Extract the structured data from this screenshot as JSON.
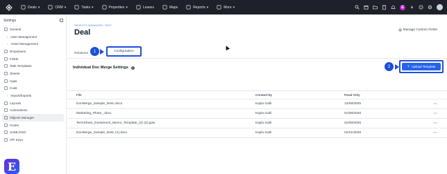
{
  "nav": {
    "items": [
      {
        "label": "Deals",
        "icon": "deals-icon",
        "has_menu": true
      },
      {
        "label": "CRM",
        "icon": "crm-icon",
        "has_menu": true
      },
      {
        "label": "Tasks",
        "icon": "tasks-icon",
        "has_menu": true
      },
      {
        "label": "Properties",
        "icon": "properties-icon",
        "has_menu": true
      },
      {
        "label": "Leases",
        "icon": "leases-icon",
        "has_menu": false
      },
      {
        "label": "Maps",
        "icon": "maps-icon",
        "has_menu": false
      },
      {
        "label": "Reports",
        "icon": "reports-icon",
        "has_menu": true
      },
      {
        "label": "More",
        "icon": "more-icon",
        "has_menu": true
      }
    ],
    "avatar_letter": "E"
  },
  "sidebar": {
    "title": "Settings",
    "items": [
      {
        "label": "General",
        "icon": "gear-icon",
        "type": "top"
      },
      {
        "label": "User Management",
        "type": "sub"
      },
      {
        "label": "Asset Management",
        "type": "sub"
      },
      {
        "label": "Dropdowns",
        "icon": "dropdown-icon",
        "type": "top"
      },
      {
        "label": "Fields",
        "icon": "fields-icon",
        "type": "top"
      },
      {
        "label": "Task Templates",
        "icon": "task-template-icon",
        "type": "top"
      },
      {
        "label": "Sheets",
        "icon": "sheets-icon",
        "type": "top"
      },
      {
        "label": "Apps",
        "icon": "apps-icon",
        "type": "top"
      },
      {
        "label": "Code",
        "icon": "code-icon",
        "type": "top"
      },
      {
        "label": "Import/Exports",
        "type": "sub"
      },
      {
        "label": "Layouts",
        "icon": "layouts-icon",
        "type": "top"
      },
      {
        "label": "Automations",
        "icon": "automations-icon",
        "type": "top"
      },
      {
        "label": "Objects Manager",
        "icon": "objects-icon",
        "type": "top",
        "active": true
      },
      {
        "label": "Hooks",
        "icon": "hooks-icon",
        "type": "top"
      },
      {
        "label": "SAML/SSO",
        "icon": "saml-icon",
        "type": "top"
      },
      {
        "label": "API Keys",
        "icon": "key-icon",
        "type": "top"
      }
    ],
    "brand_letter": "E"
  },
  "main": {
    "breadcrumb": "OBJECTS MANAGER / EDIT",
    "title": "Deal",
    "manage_link": "Manage Custom Fields",
    "tabs": [
      "Relations",
      "Configuration"
    ],
    "section_title": "Individual Doc Merge Settings",
    "upload_label": "Upload Template",
    "steps": [
      "1",
      "2"
    ],
    "table": {
      "headers": {
        "file": "File",
        "created_by": "Created By",
        "read_only": "Read Only"
      },
      "rows": [
        {
          "file": "DocMerge_Sample_Desc.docx",
          "created_by": "Kayla Galli",
          "read_only": "12/08/2025"
        },
        {
          "file": "Marketing_Photo_.docx",
          "created_by": "Kayla Galli",
          "read_only": "01/08/2026"
        },
        {
          "file": "TermSheet_Investment_Memo_Template_(2) (2).pptx",
          "created_by": "Kayla Galli",
          "read_only": "01/08/2026"
        },
        {
          "file": "DocMerge_Sample_Desc (1).docx",
          "created_by": "Kayla Galli",
          "read_only": "01/21/2026"
        }
      ],
      "more_glyph": "⋯"
    }
  },
  "colors": {
    "nav_bg": "#1e2129",
    "accent": "#2563eb",
    "annotation": "#1d4ed8"
  }
}
